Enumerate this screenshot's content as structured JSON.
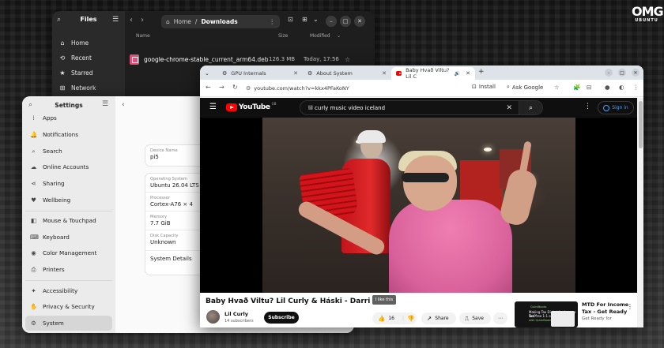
{
  "logo": {
    "line1": "OMG",
    "line2": "UBUNTU"
  },
  "files": {
    "title": "Files",
    "sidebar": [
      {
        "icon": "⌂",
        "label": "Home"
      },
      {
        "icon": "⟲",
        "label": "Recent"
      },
      {
        "icon": "★",
        "label": "Starred"
      },
      {
        "icon": "⊞",
        "label": "Network"
      }
    ],
    "path": {
      "root": "Home",
      "sep": "/",
      "current": "Downloads"
    },
    "columns": {
      "name": "Name",
      "size": "Size",
      "modified": "Modified"
    },
    "rows": [
      {
        "name": "google-chrome-stable_current_arm64.deb",
        "size": "126.3 MB",
        "modified": "Today, 17:56"
      }
    ]
  },
  "settings": {
    "title": "Settings",
    "items": [
      {
        "icon": "⁞",
        "label": "Apps"
      },
      {
        "icon": "🔔",
        "label": "Notifications"
      },
      {
        "icon": "⌕",
        "label": "Search"
      },
      {
        "icon": "☁",
        "label": "Online Accounts"
      },
      {
        "icon": "⋖",
        "label": "Sharing"
      },
      {
        "icon": "♥",
        "label": "Wellbeing"
      },
      {
        "icon": "◧",
        "label": "Mouse & Touchpad"
      },
      {
        "icon": "⌨",
        "label": "Keyboard"
      },
      {
        "icon": "◉",
        "label": "Color Management"
      },
      {
        "icon": "⎙",
        "label": "Printers"
      },
      {
        "icon": "✦",
        "label": "Accessibility"
      },
      {
        "icon": "✋",
        "label": "Privacy & Security"
      },
      {
        "icon": "⚙",
        "label": "System"
      }
    ],
    "device_name": {
      "label": "Device Name",
      "value": "pi5"
    },
    "os": {
      "label": "Operating System",
      "value": "Ubuntu 26.04 LTS"
    },
    "processor": {
      "label": "Processor",
      "value": "Cortex-A76 × 4"
    },
    "memory": {
      "label": "Memory",
      "value": "7.7 GiB"
    },
    "disk": {
      "label": "Disk Capacity",
      "value": "Unknown"
    },
    "details": "System Details"
  },
  "chrome": {
    "tabs": [
      {
        "label": "GPU Internals"
      },
      {
        "label": "About System"
      },
      {
        "label": "Baby Hvað Viltu? Lil C"
      }
    ],
    "url": "youtube.com/watch?v=kkx4PFaKoNY",
    "install": "Install",
    "ask_google": "Ask Google"
  },
  "youtube": {
    "logo_text": "YouTube",
    "country": "GB",
    "search_query": "lil curly  music video iceland",
    "signin": "Sign in",
    "video_title": "Baby Hvað Viltu? Lil Curly & Háski - Darri",
    "channel": "Lil Curly",
    "subscribers": "14 subscribers",
    "subscribe": "Subscribe",
    "likes": "16",
    "tooltip": "I like this",
    "share": "Share",
    "save": "Save",
    "rec": {
      "title_line1": "MTD For Income",
      "title_line2": "Tax - Get Ready",
      "meta": "Get Ready for",
      "thumb_line1": "QuickBooks",
      "thumb_line2": "Making Tax Digital for Income Tax?",
      "thumb_line3": "Get free 1:1 onboarding",
      "thumb_line4": "with QuickBooks"
    }
  }
}
